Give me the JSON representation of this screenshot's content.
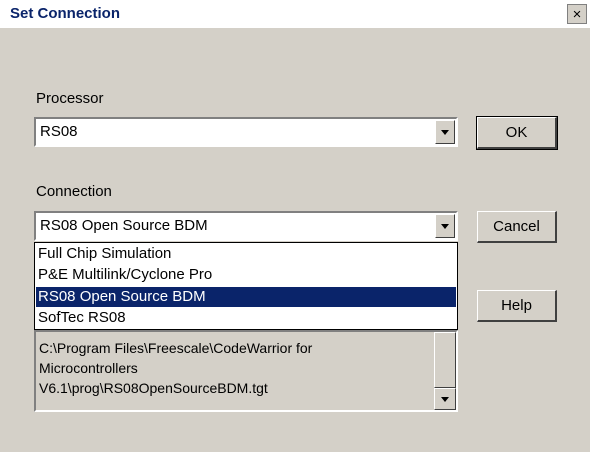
{
  "dialog": {
    "title": "Set Connection",
    "close_glyph": "×"
  },
  "processor": {
    "label": "Processor",
    "selected": "RS08"
  },
  "connection": {
    "label": "Connection",
    "selected": "RS08 Open Source BDM",
    "options": [
      "Full Chip Simulation",
      "P&E Multilink/Cyclone Pro",
      "RS08 Open Source BDM",
      "SofTec RS08"
    ],
    "highlighted_index": 2
  },
  "path_box": {
    "lines": [
      "C:\\Program Files\\Freescale\\CodeWarrior for",
      "Microcontrollers",
      "V6.1\\prog\\RS08OpenSourceBDM.tgt"
    ]
  },
  "buttons": {
    "ok": "OK",
    "cancel": "Cancel",
    "help": "Help"
  },
  "colors": {
    "dialog_bg": "#d4d0c8",
    "highlight": "#0a246a",
    "title_text": "#0a246a"
  }
}
